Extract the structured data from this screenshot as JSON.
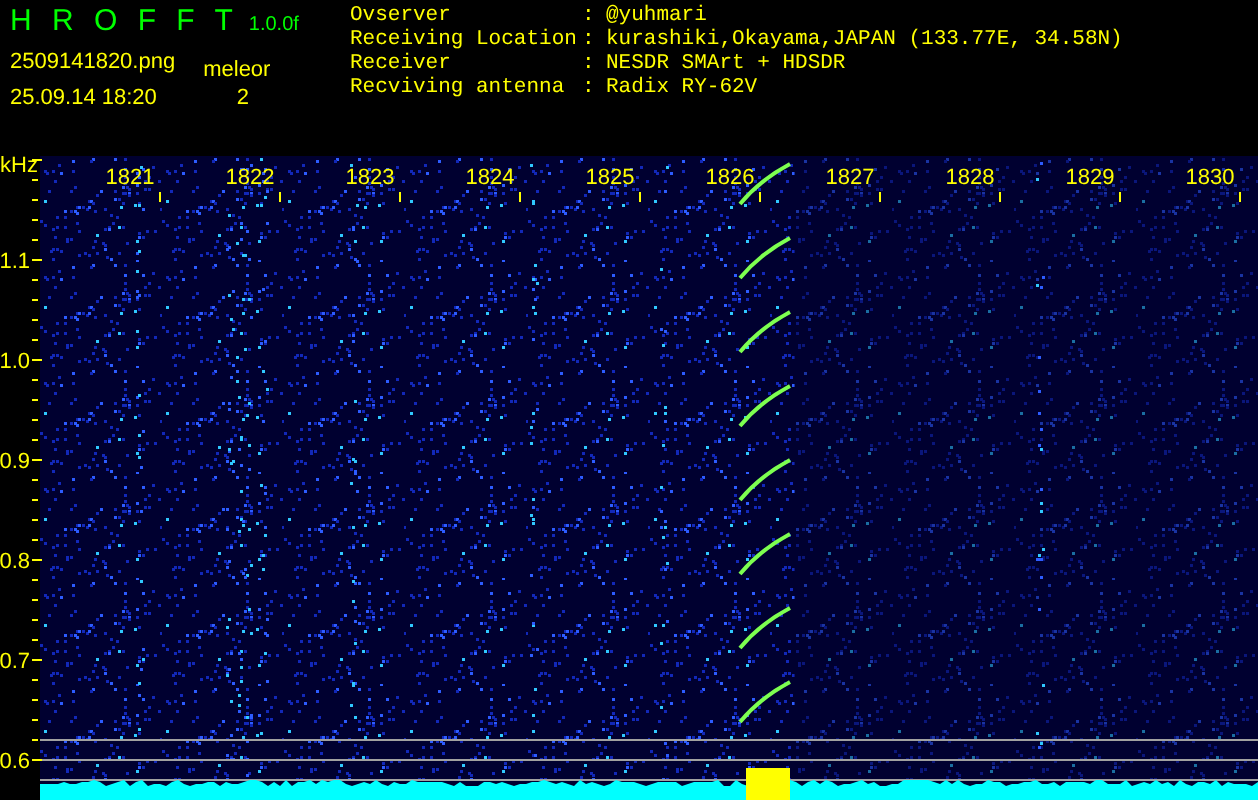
{
  "header": {
    "title": "H R O F F T",
    "version": "1.0.0f",
    "filename": "2509141820.png",
    "datetime": "25.09.14 18:20",
    "meteor_label": "meleor",
    "meteor_count": "2"
  },
  "info": [
    {
      "label": "Ovserver",
      "separator": ":",
      "value": "@yuhmari"
    },
    {
      "label": "Receiving Location",
      "separator": ":",
      "value": "kurashiki,Okayama,JAPAN (133.77E, 34.58N)"
    },
    {
      "label": "Receiver",
      "separator": ":",
      "value": "NESDR SMArt + HDSDR"
    },
    {
      "label": "Recviving antenna",
      "separator": ":",
      "value": "Radix RY-62V"
    }
  ],
  "spectrogram": {
    "unit": "kHz",
    "time_labels": [
      "1821",
      "1822",
      "1823",
      "1824",
      "1825",
      "1826",
      "1827",
      "1828",
      "1829",
      "1830"
    ],
    "frequency_labels": [
      "1.1",
      "1.0",
      "0.9",
      "0.8",
      "0.7",
      "0.6"
    ]
  }
}
